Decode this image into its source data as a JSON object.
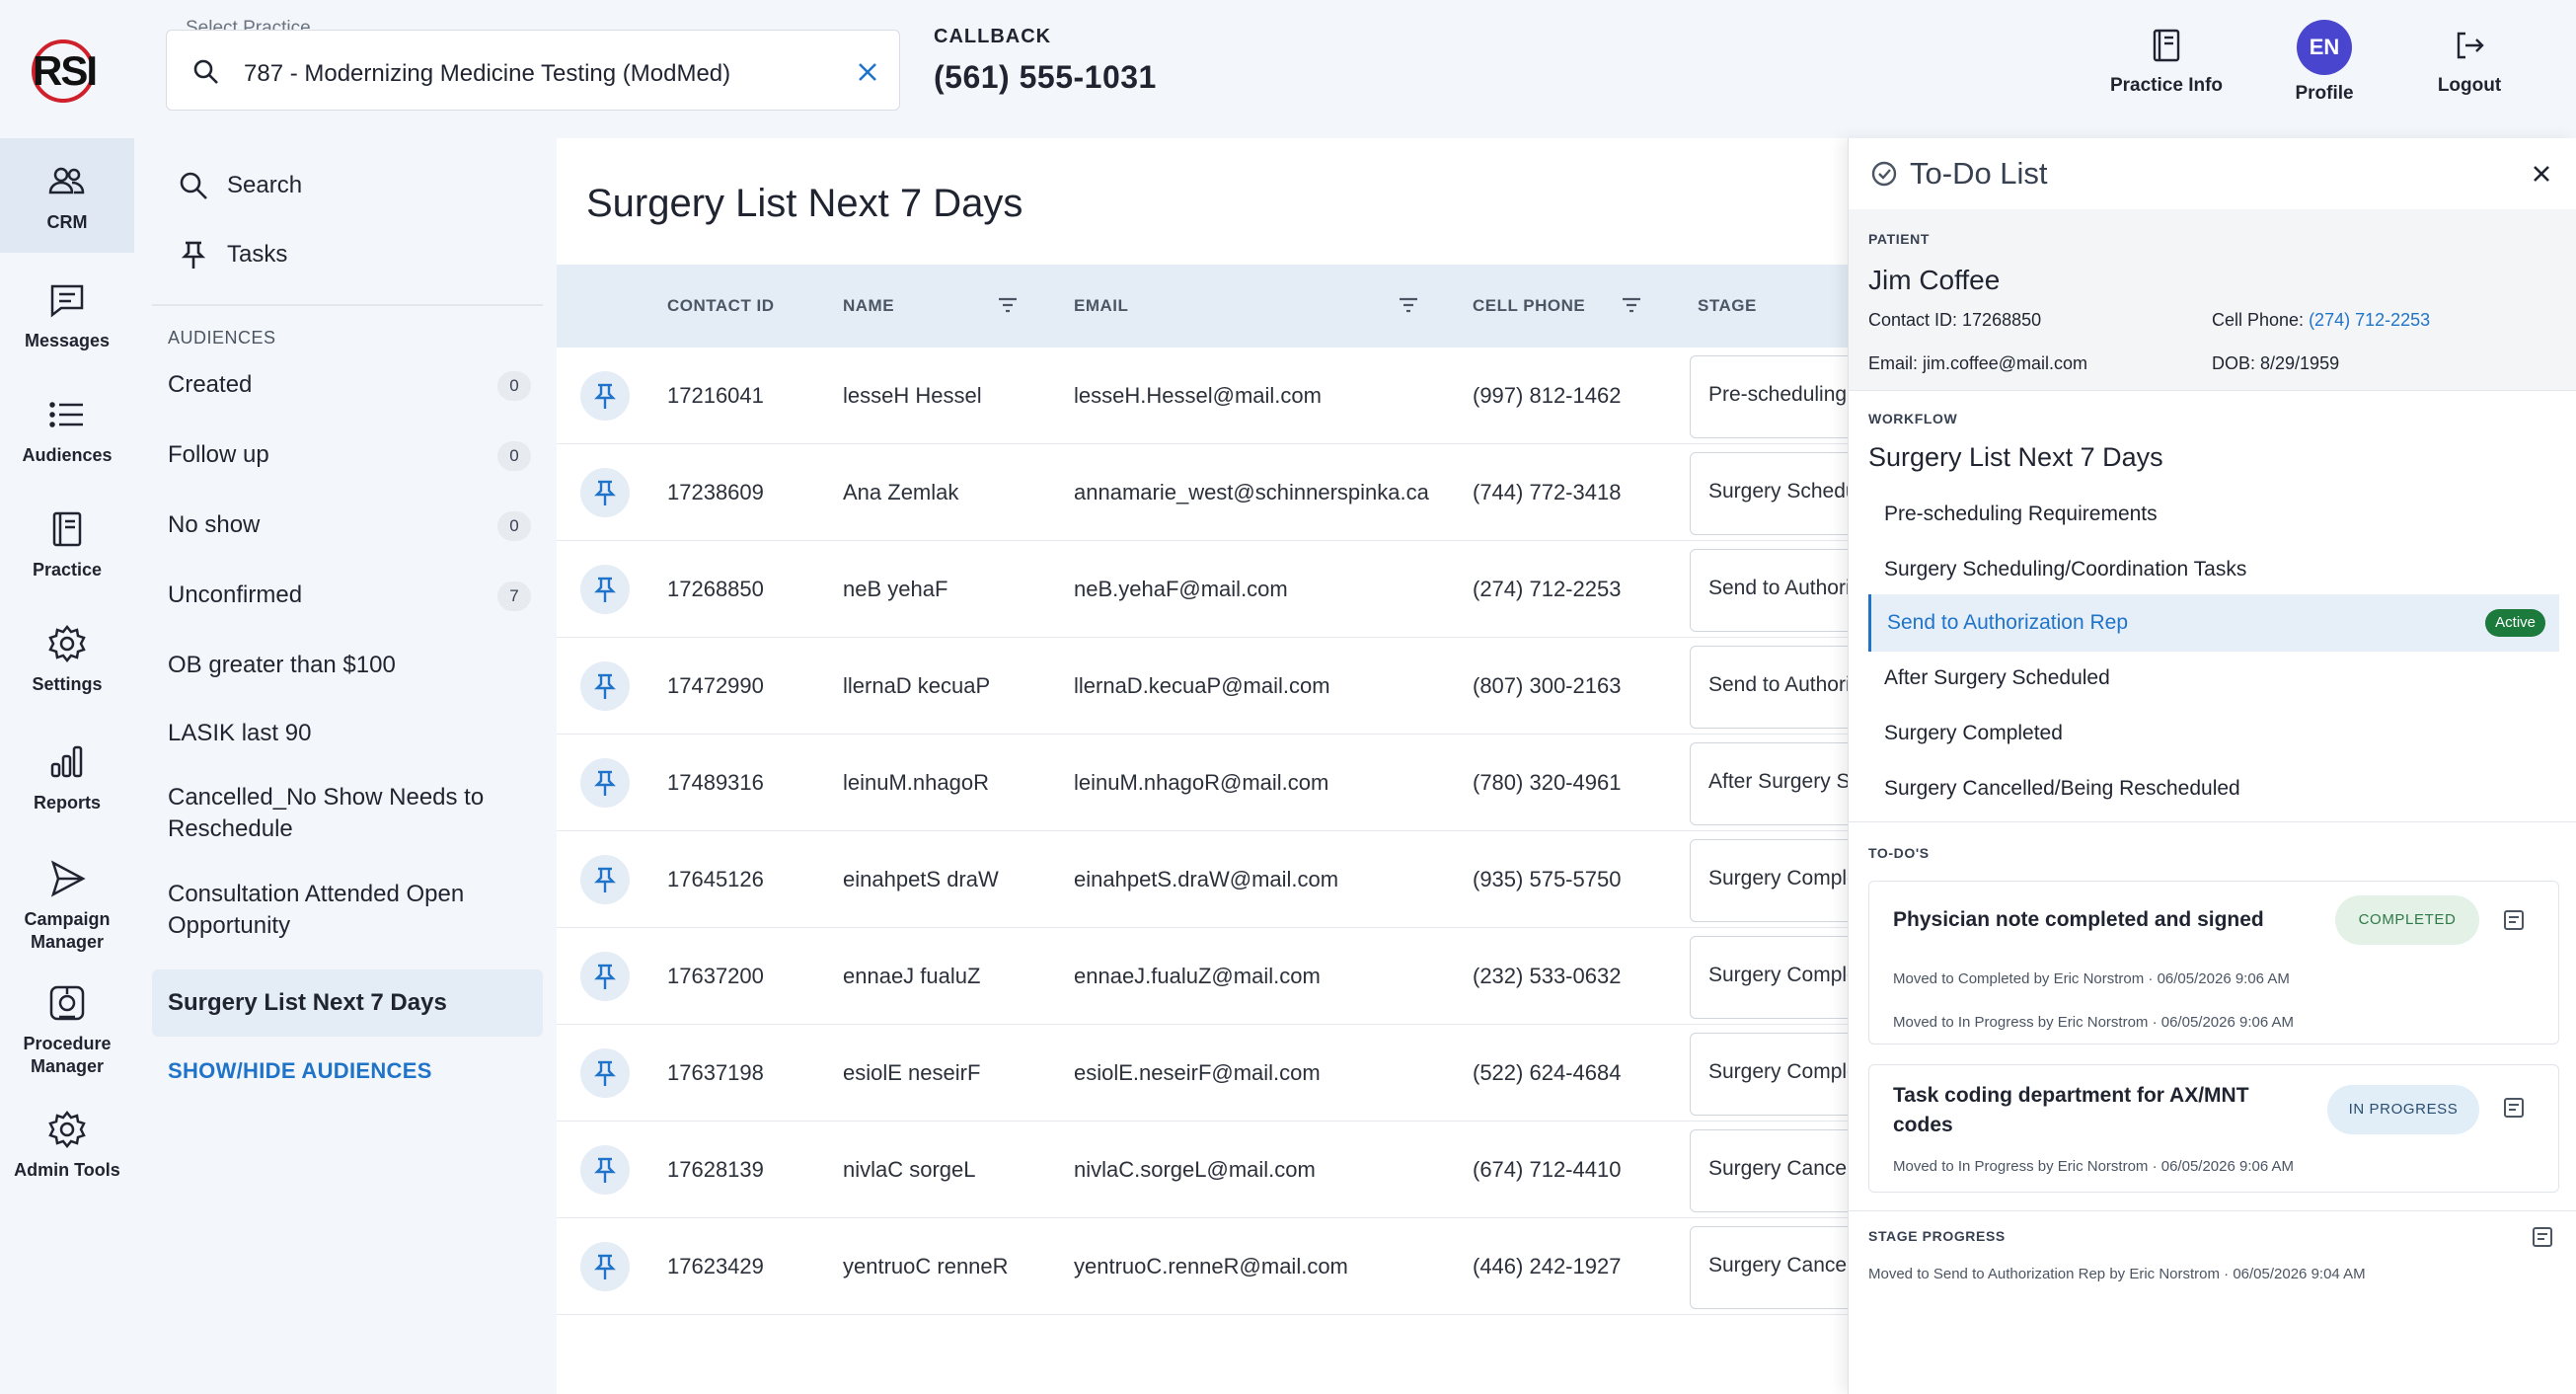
{
  "brand": {
    "logo_text": "RSI",
    "accent_color": "#d0202c"
  },
  "rail": {
    "items": [
      {
        "label": "CRM",
        "icon": "users-icon",
        "active": true
      },
      {
        "label": "Messages",
        "icon": "message-icon"
      },
      {
        "label": "Audiences",
        "icon": "list-icon"
      },
      {
        "label": "Practice",
        "icon": "notebook-icon"
      },
      {
        "label": "Settings",
        "icon": "gear-icon"
      },
      {
        "label": "Reports",
        "icon": "bar-chart-icon"
      },
      {
        "label": "Campaign Manager",
        "icon": "send-icon"
      },
      {
        "label": "Procedure Manager",
        "icon": "procedure-icon"
      },
      {
        "label": "Admin Tools",
        "icon": "gear-icon"
      }
    ]
  },
  "header": {
    "practice_label": "Select Practice",
    "practice_value": "787 - Modernizing Medicine Testing (ModMed)",
    "callback_label": "CALLBACK",
    "callback_phone": "(561) 555-1031",
    "actions": {
      "practice_info": "Practice Info",
      "profile": "Profile",
      "avatar_initials": "EN",
      "logout": "Logout"
    }
  },
  "sidebar": {
    "search": "Search",
    "tasks": "Tasks",
    "audiences_header": "AUDIENCES",
    "audiences": [
      {
        "label": "Created",
        "count": "0"
      },
      {
        "label": "Follow up",
        "count": "0"
      },
      {
        "label": "No show",
        "count": "0"
      },
      {
        "label": "Unconfirmed",
        "count": "7"
      },
      {
        "label": "OB greater than $100"
      },
      {
        "label": "LASIK last 90"
      },
      {
        "label": "Cancelled_No Show Needs to Reschedule"
      },
      {
        "label": "Consultation Attended Open Opportunity"
      },
      {
        "label": "Surgery List Next 7 Days",
        "selected": true
      }
    ],
    "show_hide": "SHOW/HIDE AUDIENCES"
  },
  "main": {
    "title": "Surgery List Next 7 Days",
    "columns": {
      "contact_id": "CONTACT ID",
      "name": "NAME",
      "email": "EMAIL",
      "cell_phone": "CELL PHONE",
      "stage": "STAGE"
    },
    "rows": [
      {
        "contact_id": "17216041",
        "name": "lesseH Hessel",
        "email": "lesseH.Hessel@mail.com",
        "phone": "(997) 812-1462",
        "stage": "Pre-scheduling"
      },
      {
        "contact_id": "17238609",
        "name": "Ana Zemlak",
        "email": "annamarie_west@schinnerspinka.ca",
        "phone": "(744) 772-3418",
        "stage": "Surgery Schedu"
      },
      {
        "contact_id": "17268850",
        "name": "neB yehaF",
        "email": "neB.yehaF@mail.com",
        "phone": "(274) 712-2253",
        "stage": "Send to Authori"
      },
      {
        "contact_id": "17472990",
        "name": "llernaD kecuaP",
        "email": "llernaD.kecuaP@mail.com",
        "phone": "(807) 300-2163",
        "stage": "Send to Authori"
      },
      {
        "contact_id": "17489316",
        "name": "leinuM.nhagoR",
        "email": "leinuM.nhagoR@mail.com",
        "phone": "(780) 320-4961",
        "stage": "After Surgery S"
      },
      {
        "contact_id": "17645126",
        "name": "einahpetS draW",
        "email": "einahpetS.draW@mail.com",
        "phone": "(935) 575-5750",
        "stage": "Surgery Comple"
      },
      {
        "contact_id": "17637200",
        "name": "ennaeJ fualuZ",
        "email": "ennaeJ.fualuZ@mail.com",
        "phone": "(232) 533-0632",
        "stage": "Surgery Comple"
      },
      {
        "contact_id": "17637198",
        "name": "esiolE neseirF",
        "email": "esiolE.neseirF@mail.com",
        "phone": "(522) 624-4684",
        "stage": "Surgery Comple"
      },
      {
        "contact_id": "17628139",
        "name": "nivlaC sorgeL",
        "email": "nivlaC.sorgeL@mail.com",
        "phone": "(674) 712-4410",
        "stage": "Surgery Cancel"
      },
      {
        "contact_id": "17623429",
        "name": "yentruoC renneR",
        "email": "yentruoC.renneR@mail.com",
        "phone": "(446) 242-1927",
        "stage": "Surgery Cancel"
      }
    ]
  },
  "todo": {
    "title": "To-Do List",
    "patient_cap": "PATIENT",
    "patient_name": "Jim Coffee",
    "contact_id_label": "Contact ID: 17268850",
    "cell_label": "Cell Phone: ",
    "cell_value": "(274) 712-2253",
    "email_label": "Email: jim.coffee@mail.com",
    "dob_label": "DOB: 8/29/1959",
    "workflow_cap": "WORKFLOW",
    "workflow_name": "Surgery List Next 7 Days",
    "steps": [
      "Pre-scheduling Requirements",
      "Surgery Scheduling/Coordination Tasks",
      "Send to Authorization Rep",
      "After Surgery Scheduled",
      "Surgery Completed",
      "Surgery Cancelled/Being Rescheduled"
    ],
    "active_badge": "Active",
    "todos_cap": "TO-DO'S",
    "cards": [
      {
        "title": "Physician note completed and signed",
        "status": "COMPLETED",
        "meta1": "Moved to Completed by Eric Norstrom · 06/05/2026 9:06 AM",
        "meta2": "Moved to In Progress by Eric Norstrom · 06/05/2026 9:06 AM"
      },
      {
        "title_line1": "Task coding department for AX/MNT",
        "title_line2": "codes",
        "status": "IN PROGRESS",
        "meta1": "Moved to In Progress by Eric Norstrom · 06/05/2026 9:06 AM"
      }
    ],
    "stage_progress_cap": "STAGE PROGRESS",
    "stage_progress_text": "Moved to Send to Authorization Rep by Eric Norstrom · 06/05/2026 9:04 AM"
  }
}
